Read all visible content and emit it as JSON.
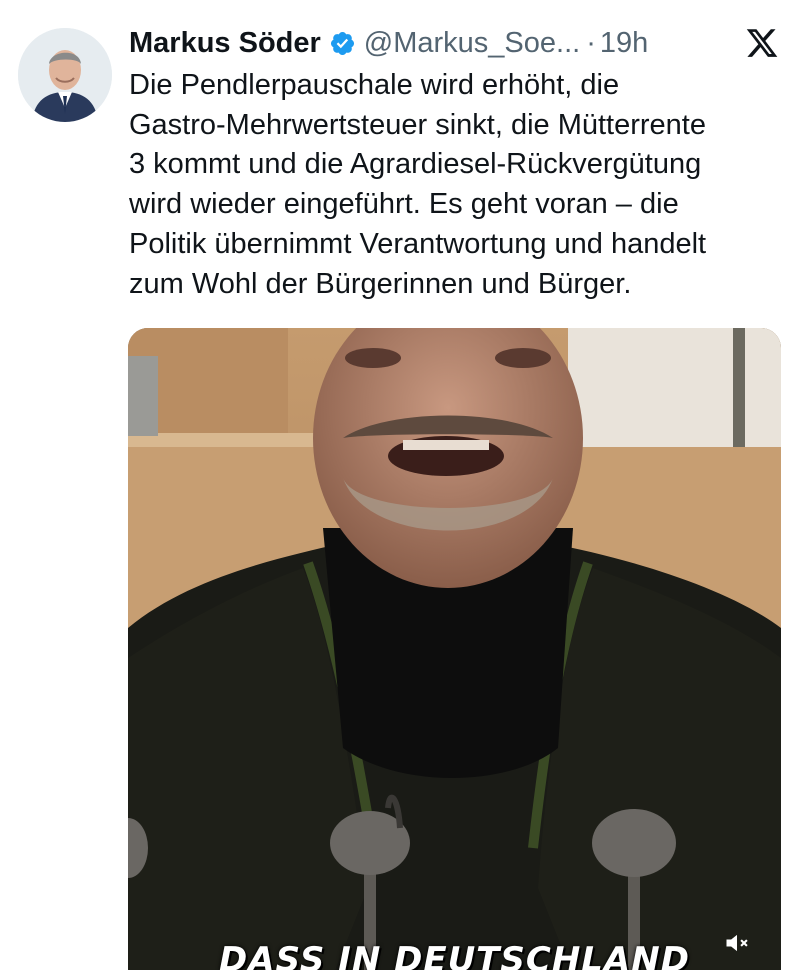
{
  "tweet": {
    "author_name": "Markus Söder",
    "handle": "@Markus_Soe...",
    "separator": "·",
    "time": "19h",
    "text_lines": [
      "Die Pendlerpauschale wird erhöht, die",
      "Gastro-Mehrwertsteuer sinkt, die Mütterrente",
      "3 kommt und die Agrardiesel-Rückvergütung",
      "wird wieder eingeführt. Es geht voran – die",
      "Politik übernimmt Verantwortung und handelt",
      "zum Wohl der Bürgerinnen und Bürger."
    ]
  },
  "media": {
    "caption": "DASS IN DEUTSCHLAND"
  },
  "icons": {
    "verified": "verified-badge-icon",
    "platform": "x-logo-icon",
    "mute": "volume-muted-icon"
  },
  "colors": {
    "text": "#0f1419",
    "secondary": "#536471",
    "verified": "#1d9bf0"
  }
}
